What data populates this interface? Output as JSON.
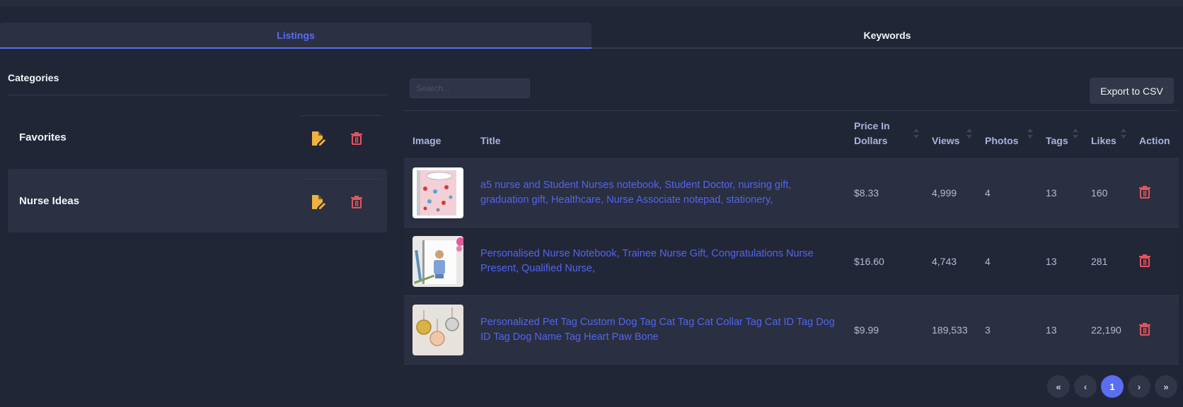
{
  "tabs": [
    {
      "label": "Listings",
      "active": true
    },
    {
      "label": "Keywords",
      "active": false
    }
  ],
  "sidebar": {
    "title": "Categories",
    "items": [
      {
        "name": "Favorites",
        "edit_icon": "edit-file-icon",
        "delete_icon": "trash-icon"
      },
      {
        "name": "Nurse Ideas",
        "edit_icon": "edit-file-icon",
        "delete_icon": "trash-icon"
      }
    ]
  },
  "search": {
    "placeholder": "Search...",
    "value": ""
  },
  "toolbar": {
    "export_label": "Export to CSV"
  },
  "table": {
    "columns": [
      {
        "label": "Image",
        "sortable": false
      },
      {
        "label": "Title",
        "sortable": false
      },
      {
        "label": "Price In Dollars",
        "sortable": true
      },
      {
        "label": "Views",
        "sortable": true
      },
      {
        "label": "Photos",
        "sortable": true
      },
      {
        "label": "Tags",
        "sortable": true
      },
      {
        "label": "Likes",
        "sortable": true
      },
      {
        "label": "Action",
        "sortable": false
      }
    ],
    "rows": [
      {
        "image": "pink nurse notebook thumbnail",
        "title": "a5 nurse and Student Nurses notebook, Student Doctor, nursing gift, graduation gift, Healthcare, Nurse Associate notepad, stationery,",
        "price": "$8.33",
        "views": "4,999",
        "photos": "4",
        "tags": "13",
        "likes": "160",
        "action_icon": "trash-icon"
      },
      {
        "image": "personalised nurse notebook thumbnail",
        "title": "Personalised Nurse Notebook, Trainee Nurse Gift, Congratulations Nurse Present, Qualified Nurse,",
        "price": "$16.60",
        "views": "4,743",
        "photos": "4",
        "tags": "13",
        "likes": "281",
        "action_icon": "trash-icon"
      },
      {
        "image": "pet tags thumbnail",
        "title": "Personalized Pet Tag Custom Dog Tag Cat Tag Cat Collar Tag Cat ID Tag Dog ID Tag Dog Name Tag Heart Paw Bone",
        "price": "$9.99",
        "views": "189,533",
        "photos": "3",
        "tags": "13",
        "likes": "22,190",
        "action_icon": "trash-icon"
      }
    ]
  },
  "pagination": {
    "first": "«",
    "prev": "‹",
    "current": "1",
    "next": "›",
    "last": "»"
  },
  "colors": {
    "background": "#212636",
    "accent": "#5a6cf0",
    "link": "#5166ee",
    "edit": "#f0b13f",
    "delete": "#e5545b"
  }
}
